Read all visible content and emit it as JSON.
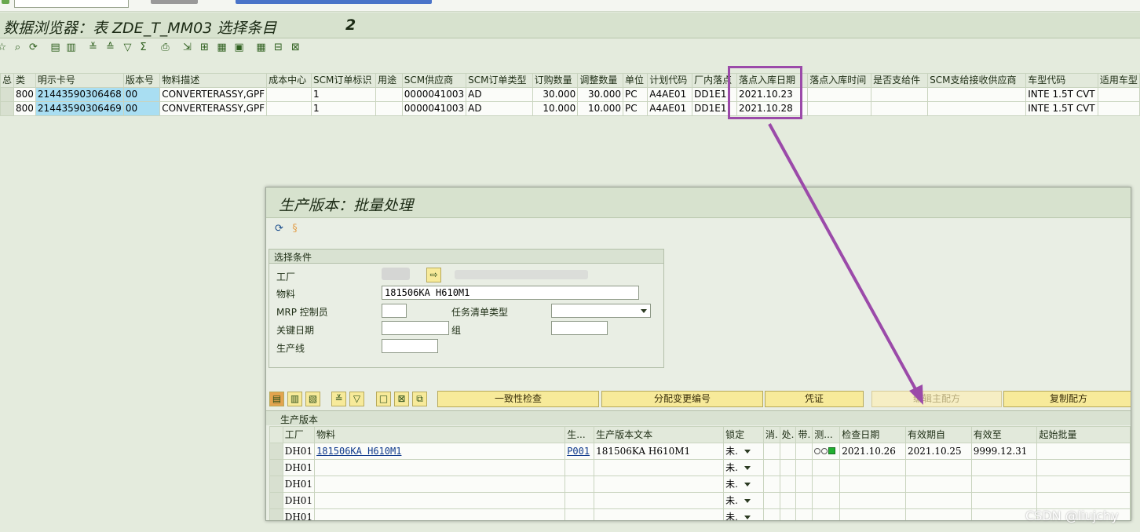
{
  "main": {
    "title": "数据浏览器：表 ZDE_T_MM03 选择条目",
    "count": "2",
    "columns": [
      "总",
      "类",
      "明示卡号",
      "版本号",
      "物料描述",
      "成本中心",
      "SCM订单标识",
      "用途",
      "SCM供应商",
      "SCM订单类型",
      "订购数量",
      "调整数量",
      "单位",
      "计划代码",
      "厂内落点",
      "落点入库日期",
      "落点入库时间",
      "是否支给件",
      "SCM支给接收供应商",
      "车型代码",
      "适用车型"
    ],
    "rows": [
      [
        "",
        "800",
        "21443590306468",
        "00",
        "CONVERTERASSY,GPF",
        "",
        "1",
        "",
        "0000041003",
        "AD",
        "30.000",
        "30.000",
        "PC",
        "A4AE01",
        "DD1E1",
        "2021.10.23",
        "",
        "",
        "",
        "INTE 1.5T CVT",
        ""
      ],
      [
        "",
        "800",
        "21443590306469",
        "00",
        "CONVERTERASSY,GPF",
        "",
        "1",
        "",
        "0000041003",
        "AD",
        "10.000",
        "10.000",
        "PC",
        "A4AE01",
        "DD1E1",
        "2021.10.28",
        "",
        "",
        "",
        "INTE 1.5T CVT",
        ""
      ]
    ]
  },
  "popup": {
    "title": "生产版本：批量处理",
    "selection": {
      "header": "选择条件",
      "plant_label": "工厂",
      "material_label": "物料",
      "material_value": "181506KA H610M1",
      "mrp_label": "MRP 控制员",
      "task_list_type_label": "任务清单类型",
      "key_date_label": "关键日期",
      "group_label": "组",
      "line_label": "生产线"
    },
    "buttons": {
      "consistency": "一致性检查",
      "assign_change": "分配变更编号",
      "voucher": "凭证",
      "edit_master_recipe": "编辑主配方",
      "copy_recipe": "复制配方"
    },
    "section_label": "生产版本",
    "columns": [
      "工厂",
      "物料",
      "生...",
      "生产版本文本",
      "锁定",
      "消.",
      "处.",
      "带.",
      "测...",
      "检查日期",
      "有效期自",
      "有效至",
      "起始批量"
    ],
    "rows": [
      {
        "plant": "DH01",
        "material": "181506KA H610M1",
        "version": "P001",
        "text": "181506KA H610M1",
        "lock": "未.",
        "check_date": "2021.10.26",
        "valid_from": "2021.10.25",
        "valid_to": "9999.12.31"
      },
      {
        "plant": "DH01",
        "material": "",
        "version": "",
        "text": "",
        "lock": "未.",
        "check_date": "",
        "valid_from": "",
        "valid_to": ""
      },
      {
        "plant": "DH01",
        "material": "",
        "version": "",
        "text": "",
        "lock": "未.",
        "check_date": "",
        "valid_from": "",
        "valid_to": ""
      },
      {
        "plant": "DH01",
        "material": "",
        "version": "",
        "text": "",
        "lock": "未.",
        "check_date": "",
        "valid_from": "",
        "valid_to": ""
      },
      {
        "plant": "DH01",
        "material": "",
        "version": "",
        "text": "",
        "lock": "未.",
        "check_date": "",
        "valid_from": "",
        "valid_to": ""
      }
    ]
  },
  "annotation": {
    "color": "#9b4aa9"
  },
  "watermark": "CSDN @liujchy"
}
